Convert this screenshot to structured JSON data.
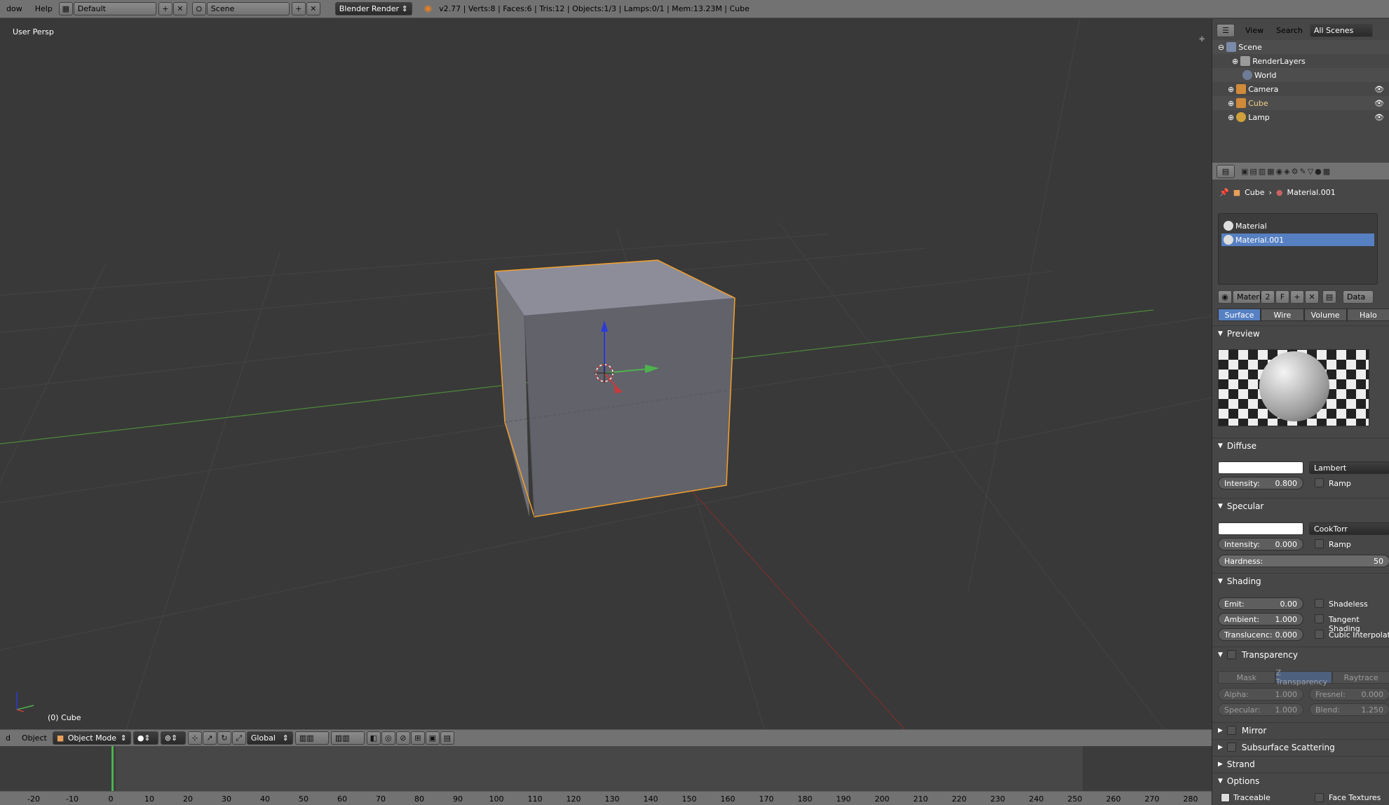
{
  "topbar": {
    "menu_window": "dow",
    "menu_help": "Help",
    "layout": "Default",
    "scene": "Scene",
    "engine": "Blender Render",
    "stats": "v2.77 | Verts:8 | Faces:6 | Tris:12 | Objects:1/3 | Lamps:0/1 | Mem:13.23M | Cube"
  },
  "viewport": {
    "view_label": "User Persp",
    "object_label": "(0) Cube"
  },
  "vp_header": {
    "menu_add": "d",
    "menu_object": "Object",
    "mode": "Object Mode",
    "orientation": "Global"
  },
  "timeline": {
    "ticks": [
      "-20",
      "-10",
      "0",
      "10",
      "20",
      "30",
      "40",
      "50",
      "60",
      "70",
      "80",
      "90",
      "100",
      "110",
      "120",
      "130",
      "140",
      "150",
      "160",
      "170",
      "180",
      "190",
      "200",
      "210",
      "220",
      "230",
      "240",
      "250",
      "260",
      "270",
      "280"
    ]
  },
  "outliner": {
    "view": "View",
    "search": "Search",
    "filter": "All Scenes",
    "items": [
      "Scene",
      "RenderLayers",
      "World",
      "Camera",
      "Cube",
      "Lamp"
    ]
  },
  "properties": {
    "breadcrumb_object": "Cube",
    "breadcrumb_material": "Material.001",
    "slots": [
      "Material",
      "Material.001"
    ],
    "mat_name": "Materi",
    "mat_users": "2",
    "mat_fake": "F",
    "link": "Data",
    "tabs": [
      "Surface",
      "Wire",
      "Volume",
      "Halo"
    ],
    "preview": "Preview",
    "diffuse": {
      "title": "Diffuse",
      "shader": "Lambert",
      "intensity_label": "Intensity:",
      "intensity": "0.800",
      "ramp": "Ramp"
    },
    "specular": {
      "title": "Specular",
      "shader": "CookTorr",
      "intensity_label": "Intensity:",
      "intensity": "0.000",
      "ramp": "Ramp",
      "hardness_label": "Hardness:",
      "hardness": "50"
    },
    "shading": {
      "title": "Shading",
      "emit_label": "Emit:",
      "emit": "0.00",
      "ambient_label": "Ambient:",
      "ambient": "1.000",
      "transl_label": "Translucenc:",
      "transl": "0.000",
      "shadeless": "Shadeless",
      "tangent": "Tangent Shading",
      "cubic": "Cubic Interpolatio"
    },
    "transparency": {
      "title": "Transparency",
      "modes": [
        "Mask",
        "Z Transparency",
        "Raytrace"
      ],
      "alpha_label": "Alpha:",
      "alpha": "1.000",
      "fresnel_label": "Fresnel:",
      "fresnel": "0.000",
      "spec_label": "Specular:",
      "spec": "1.000",
      "blend_label": "Blend:",
      "blend": "1.250"
    },
    "mirror": "Mirror",
    "sss": "Subsurface Scattering",
    "strand": "Strand",
    "options": "Options",
    "traceable": "Traceable",
    "face_textures": "Face Textures"
  },
  "colors": {
    "selection": "#f5a02a",
    "accent": "#5680c2",
    "x_axis": "#c83a3a",
    "y_axis": "#4cb34c",
    "z_axis": "#2a3bd8"
  }
}
